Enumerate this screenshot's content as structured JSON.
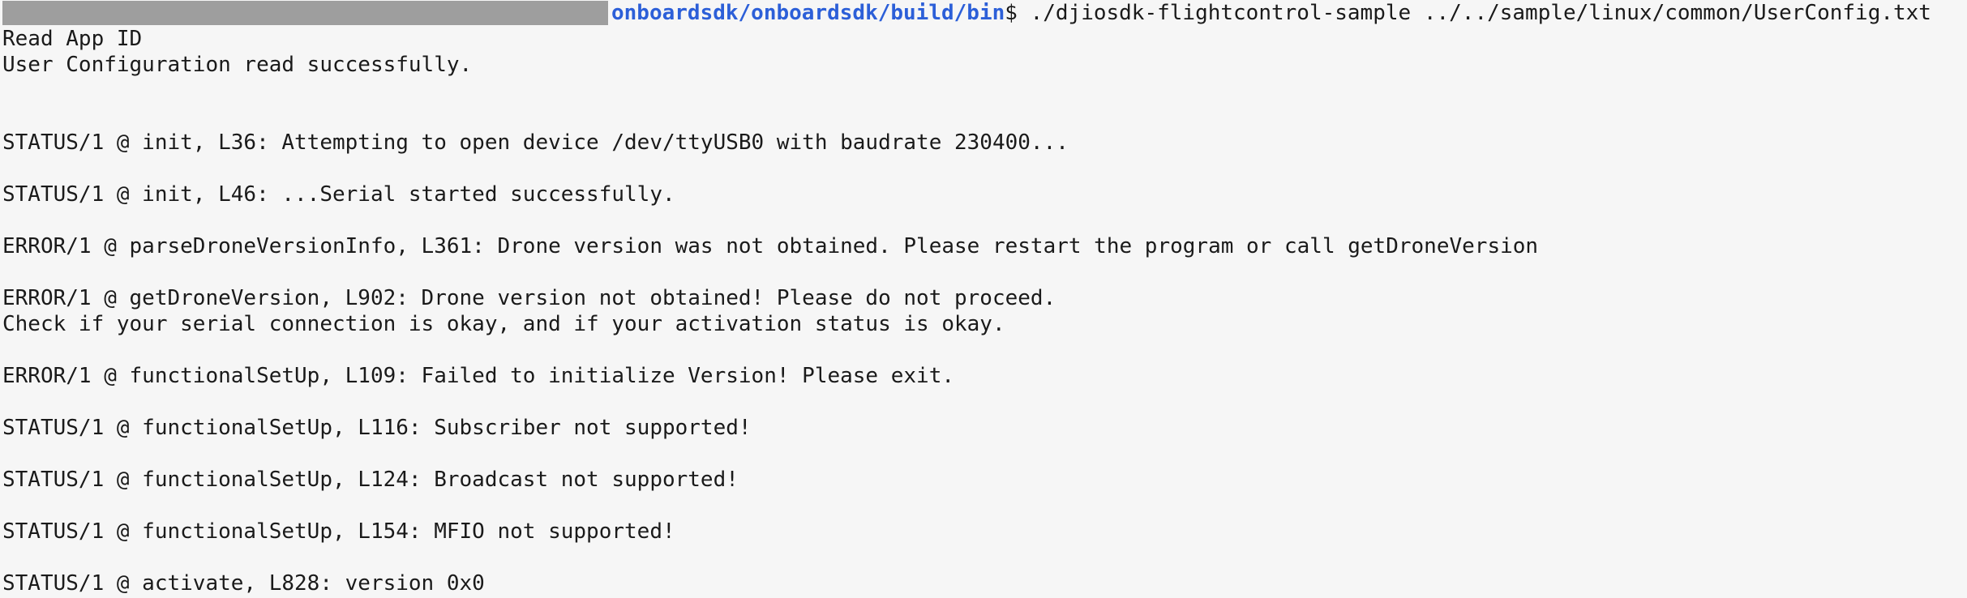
{
  "prompt": {
    "path": "onboardsdk/onboardsdk/build/bin",
    "symbol": "$",
    "command": " ./djiosdk-flightcontrol-sample ../../sample/linux/common/UserConfig.txt"
  },
  "output_lines": [
    "Read App ID",
    "User Configuration read successfully.",
    "",
    "",
    "STATUS/1 @ init, L36: Attempting to open device /dev/ttyUSB0 with baudrate 230400...",
    "",
    "STATUS/1 @ init, L46: ...Serial started successfully.",
    "",
    "ERROR/1 @ parseDroneVersionInfo, L361: Drone version was not obtained. Please restart the program or call getDroneVersion",
    "",
    "ERROR/1 @ getDroneVersion, L902: Drone version not obtained! Please do not proceed.",
    "Check if your serial connection is okay, and if your activation status is okay.",
    "",
    "ERROR/1 @ functionalSetUp, L109: Failed to initialize Version! Please exit.",
    "",
    "STATUS/1 @ functionalSetUp, L116: Subscriber not supported!",
    "",
    "STATUS/1 @ functionalSetUp, L124: Broadcast not supported!",
    "",
    "STATUS/1 @ functionalSetUp, L154: MFIO not supported!",
    "",
    "STATUS/1 @ activate, L828: version 0x0"
  ],
  "colors": {
    "background": "#f6f6f6",
    "text": "#1a1a1a",
    "path": "#2c5fd8",
    "redaction": "#9e9e9e"
  }
}
